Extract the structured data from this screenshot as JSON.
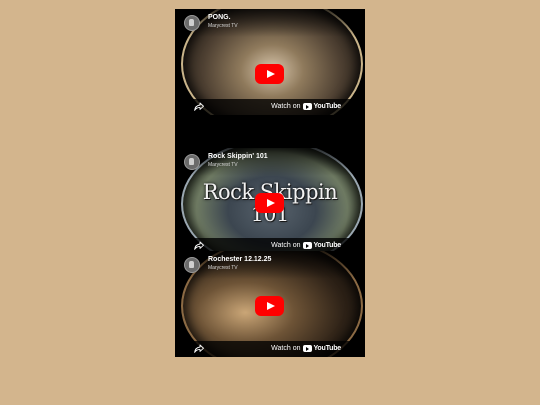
{
  "videos": [
    {
      "title": "PONG.",
      "channel": "Marycrest TV",
      "overlay": [
        "",
        ""
      ],
      "watch_label": "Watch on",
      "logo_text": "YouTube"
    },
    {
      "title": "Rock Skippin' 101",
      "channel": "Marycrest TV",
      "overlay": [
        "Rock Skippin",
        "101"
      ],
      "watch_label": "Watch on",
      "logo_text": "YouTube"
    },
    {
      "title": "Rochester 12.12.25",
      "channel": "Marycrest TV",
      "overlay": [
        "",
        ""
      ],
      "watch_label": "Watch on",
      "logo_text": "YouTube"
    }
  ],
  "colors": {
    "page_background": "#d3b58d",
    "play_button": "#ff0000",
    "embed_background": "#000000"
  },
  "icons": [
    "channel-avatar-icon",
    "play-icon",
    "share-icon",
    "youtube-logo-icon"
  ]
}
